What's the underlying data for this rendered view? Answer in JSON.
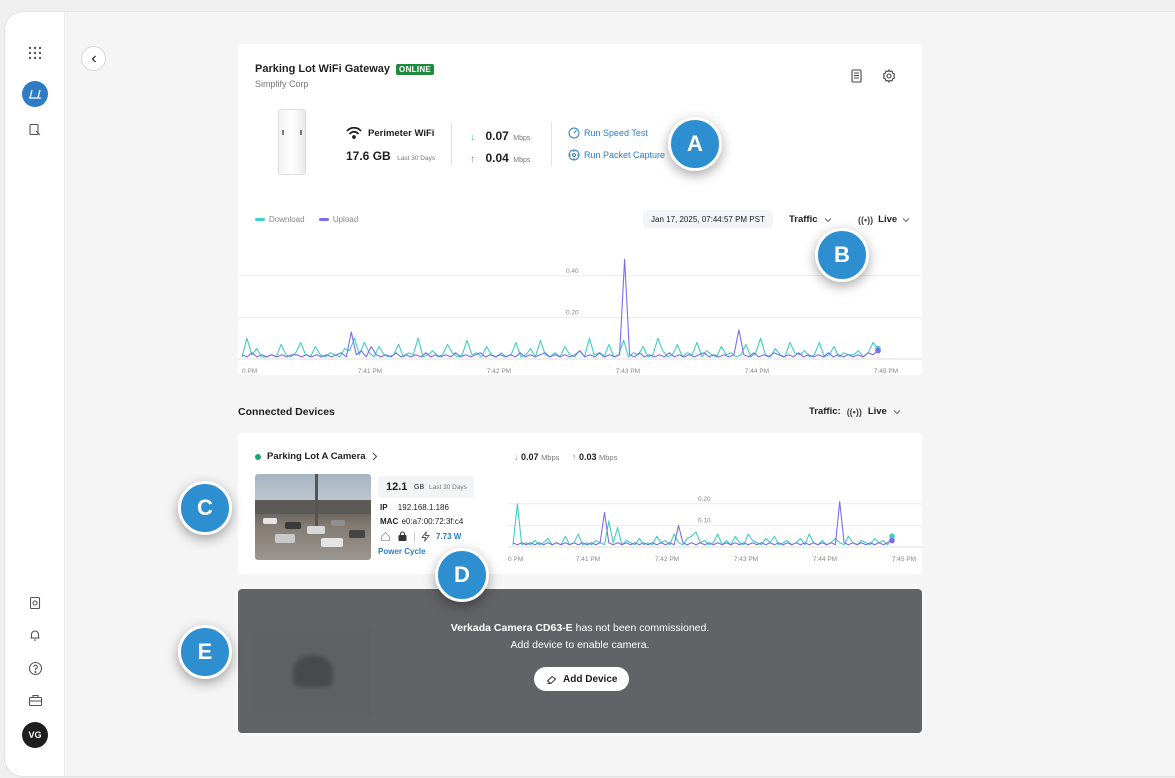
{
  "device": {
    "name": "Parking Lot WiFi Gateway",
    "status": "ONLINE",
    "org": "Simplify Corp",
    "network": "Perimeter WiFi",
    "usage_value": "17.6 GB",
    "usage_period": "Last 30 Days",
    "download_value": "0.07",
    "upload_value": "0.04",
    "unit": "Mbps",
    "run_speed_test": "Run Speed Test",
    "run_packet_capture": "Run Packet Capture"
  },
  "chart_controls": {
    "legend_download": "Download",
    "legend_upload": "Upload",
    "timestamp": "Jan 17, 2025, 07:44:57 PM PST",
    "metric": "Traffic",
    "mode": "Live"
  },
  "connected": {
    "title": "Connected Devices",
    "traffic_label": "Traffic:",
    "mode": "Live"
  },
  "camera": {
    "name": "Parking Lot A Camera",
    "usage_value": "12.1",
    "usage_unit": "GB",
    "usage_period": "Last 30 Days",
    "ip_label": "IP",
    "ip": "192.168.1.186",
    "mac_label": "MAC",
    "mac": "e0:a7:00:72:3f:c4",
    "power": "7.73 W",
    "power_cycle": "Power Cycle",
    "download_value": "0.07",
    "upload_value": "0.03",
    "unit": "Mbps"
  },
  "uncommissioned": {
    "camera_model": "Verkada Camera CD63-E",
    "message_rest": " has not been commissioned.",
    "message_line2": "Add device to enable camera.",
    "add_button": "Add Device"
  },
  "markers": [
    "A",
    "B",
    "C",
    "D",
    "E"
  ],
  "user": {
    "initials": "VG"
  },
  "colors": {
    "download": "#3fd0c0",
    "upload": "#7b6df0",
    "online": "#1e8a3c",
    "link": "#2c7fc7",
    "marker": "#2e8fd0"
  },
  "chart_data": [
    {
      "type": "line",
      "x_ticks": [
        "0 PM",
        "7:41 PM",
        "7:42 PM",
        "7:43 PM",
        "7:44 PM",
        "7:45 PM"
      ],
      "y_ticks": [
        "0.20",
        "0.40"
      ],
      "ylim": [
        0,
        0.5
      ],
      "series": [
        {
          "name": "Download",
          "values": [
            0.01,
            0.1,
            0.02,
            0.05,
            0.01,
            0.01,
            0.02,
            0.01,
            0.07,
            0.02,
            0.01,
            0.03,
            0.08,
            0.02,
            0.01,
            0.06,
            0.02,
            0.01,
            0.03,
            0.02,
            0.01,
            0.05,
            0.04,
            0.1,
            0.02,
            0.08,
            0.03,
            0.01,
            0.06,
            0.02,
            0.01,
            0.02,
            0.07,
            0.01,
            0.03,
            0.02,
            0.1,
            0.01,
            0.02,
            0.04,
            0.01,
            0.02,
            0.07,
            0.03,
            0.01,
            0.02,
            0.09,
            0.02,
            0.03,
            0.01,
            0.06,
            0.02,
            0.01,
            0.03,
            0.01,
            0.02,
            0.08,
            0.01,
            0.02,
            0.05,
            0.01,
            0.09,
            0.02,
            0.01,
            0.03,
            0.01,
            0.06,
            0.02,
            0.01,
            0.04,
            0.01,
            0.1,
            0.02,
            0.03,
            0.01,
            0.07,
            0.01,
            0.02,
            0.09,
            0.01,
            0.03,
            0.02,
            0.06,
            0.01,
            0.02,
            0.1,
            0.04,
            0.01,
            0.02,
            0.07,
            0.01,
            0.03,
            0.02,
            0.08,
            0.01,
            0.04,
            0.02,
            0.01,
            0.06,
            0.02,
            0.03,
            0.01,
            0.02,
            0.07,
            0.01,
            0.03,
            0.1,
            0.02,
            0.01,
            0.05,
            0.02,
            0.01,
            0.08,
            0.03,
            0.02,
            0.04,
            0.01,
            0.02,
            0.08,
            0.01,
            0.02,
            0.06,
            0.01,
            0.03,
            0.02,
            0.02,
            0.04,
            0.01,
            0.03,
            0.08,
            0.05
          ]
        },
        {
          "name": "Upload",
          "values": [
            0.02,
            0.01,
            0.03,
            0.01,
            0.02,
            0.01,
            0.02,
            0.01,
            0.02,
            0.01,
            0.02,
            0.02,
            0.01,
            0.02,
            0.01,
            0.02,
            0.01,
            0.02,
            0.01,
            0.02,
            0.03,
            0.01,
            0.13,
            0.02,
            0.04,
            0.01,
            0.06,
            0.02,
            0.01,
            0.02,
            0.01,
            0.03,
            0.01,
            0.02,
            0.01,
            0.02,
            0.01,
            0.03,
            0.01,
            0.02,
            0.01,
            0.02,
            0.01,
            0.03,
            0.01,
            0.02,
            0.01,
            0.02,
            0.03,
            0.01,
            0.02,
            0.01,
            0.02,
            0.01,
            0.02,
            0.01,
            0.03,
            0.01,
            0.02,
            0.01,
            0.02,
            0.03,
            0.01,
            0.02,
            0.01,
            0.02,
            0.01,
            0.02,
            0.04,
            0.01,
            0.02,
            0.01,
            0.03,
            0.01,
            0.02,
            0.01,
            0.02,
            0.48,
            0.02,
            0.01,
            0.03,
            0.01,
            0.02,
            0.01,
            0.02,
            0.01,
            0.03,
            0.01,
            0.02,
            0.01,
            0.02,
            0.01,
            0.02,
            0.03,
            0.01,
            0.02,
            0.01,
            0.02,
            0.01,
            0.02,
            0.14,
            0.02,
            0.01,
            0.03,
            0.01,
            0.02,
            0.01,
            0.03,
            0.02,
            0.01,
            0.02,
            0.01,
            0.03,
            0.01,
            0.02,
            0.01,
            0.02,
            0.01,
            0.03,
            0.01,
            0.02,
            0.01,
            0.02,
            0.01,
            0.02,
            0.01,
            0.03,
            0.02,
            0.04
          ]
        }
      ]
    },
    {
      "type": "line",
      "x_ticks": [
        "0 PM",
        "7:41 PM",
        "7:42 PM",
        "7:43 PM",
        "7:44 PM",
        "7:45 PM"
      ],
      "y_ticks": [
        "0.10",
        "0.20"
      ],
      "ylim": [
        0,
        0.25
      ],
      "series": [
        {
          "name": "Download",
          "values": [
            0.01,
            0.2,
            0.01,
            0.02,
            0.01,
            0.03,
            0.01,
            0.02,
            0.04,
            0.01,
            0.02,
            0.01,
            0.05,
            0.01,
            0.02,
            0.06,
            0.01,
            0.02,
            0.01,
            0.03,
            0.02,
            0.01,
            0.12,
            0.02,
            0.09,
            0.01,
            0.03,
            0.02,
            0.01,
            0.04,
            0.01,
            0.02,
            0.01,
            0.05,
            0.02,
            0.03,
            0.01,
            0.06,
            0.02,
            0.01,
            0.04,
            0.05,
            0.07,
            0.02,
            0.03,
            0.01,
            0.02,
            0.06,
            0.01,
            0.03,
            0.01,
            0.05,
            0.02,
            0.01,
            0.06,
            0.03,
            0.02,
            0.01,
            0.04,
            0.02,
            0.05,
            0.01,
            0.02,
            0.03,
            0.01,
            0.02,
            0.04,
            0.01,
            0.06,
            0.02,
            0.01,
            0.03,
            0.01,
            0.02,
            0.04,
            0.02,
            0.01,
            0.05,
            0.02,
            0.01,
            0.03,
            0.02,
            0.01,
            0.04,
            0.02,
            0.03,
            0.01,
            0.05
          ]
        },
        {
          "name": "Upload",
          "values": [
            0.02,
            0.01,
            0.02,
            0.01,
            0.02,
            0.01,
            0.02,
            0.01,
            0.02,
            0.01,
            0.02,
            0.01,
            0.02,
            0.01,
            0.02,
            0.01,
            0.02,
            0.01,
            0.02,
            0.01,
            0.02,
            0.16,
            0.02,
            0.01,
            0.02,
            0.01,
            0.02,
            0.01,
            0.02,
            0.01,
            0.02,
            0.01,
            0.02,
            0.01,
            0.02,
            0.01,
            0.02,
            0.01,
            0.1,
            0.02,
            0.01,
            0.02,
            0.01,
            0.02,
            0.01,
            0.02,
            0.01,
            0.02,
            0.01,
            0.02,
            0.01,
            0.02,
            0.01,
            0.02,
            0.01,
            0.02,
            0.01,
            0.02,
            0.01,
            0.02,
            0.01,
            0.02,
            0.01,
            0.02,
            0.01,
            0.02,
            0.01,
            0.02,
            0.01,
            0.02,
            0.01,
            0.02,
            0.01,
            0.02,
            0.01,
            0.21,
            0.02,
            0.01,
            0.02,
            0.01,
            0.02,
            0.01,
            0.02,
            0.01,
            0.02,
            0.01,
            0.02,
            0.03
          ]
        }
      ]
    }
  ]
}
